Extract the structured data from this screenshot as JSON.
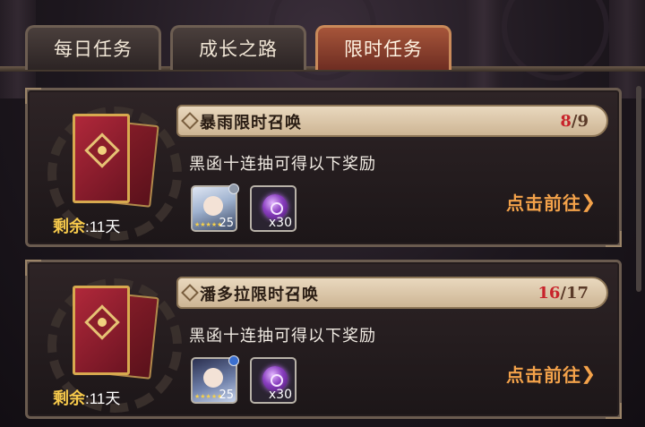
{
  "tabs": [
    {
      "label": "每日任务",
      "active": false
    },
    {
      "label": "成长之路",
      "active": false
    },
    {
      "label": "限时任务",
      "active": true
    }
  ],
  "quests": [
    {
      "title": "暴雨限时召唤",
      "progress_current": "8",
      "progress_total": "/9",
      "description": "黑函十连抽可得以下奖励",
      "remaining_label": "剩余",
      "remaining_value": ":11天",
      "rewards": [
        {
          "type": "hero",
          "level": "25",
          "stars": "★★★★★"
        },
        {
          "type": "purple-orb",
          "quantity": "x30"
        }
      ],
      "action_label": "点击前往",
      "action_icon": "chevron-right-icon"
    },
    {
      "title": "潘多拉限时召唤",
      "progress_current": "16",
      "progress_total": "/17",
      "description": "黑函十连抽可得以下奖励",
      "remaining_label": "剩余",
      "remaining_value": ":11天",
      "rewards": [
        {
          "type": "hero",
          "level": "25",
          "stars": "★★★★★"
        },
        {
          "type": "purple-orb",
          "quantity": "x30"
        }
      ],
      "action_label": "点击前往",
      "action_icon": "chevron-right-icon"
    }
  ],
  "colors": {
    "active_tab": "#a6553a",
    "progress_highlight": "#c8232b",
    "action_text": "#f3a24a",
    "remaining_label": "#f6c94b"
  }
}
